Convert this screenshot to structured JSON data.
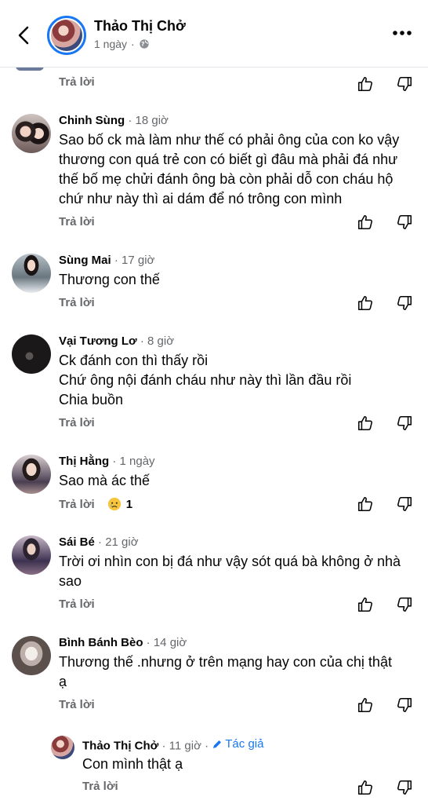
{
  "header": {
    "name": "Thảo Thị Chở",
    "time": "1 ngày",
    "separator": "·"
  },
  "partial_actions": {
    "reply": "Trả lời"
  },
  "comments": [
    {
      "name": "Chinh Sùng",
      "time": "18 giờ",
      "lines": [
        "Sao bố ck mà làm như thế có phải ông của con ko vậy",
        "thương con quá trẻ con có biết gì đâu mà phải đá như",
        "thế bố mẹ chửi đánh ông bà còn phải dỗ con cháu hộ",
        "chứ như này thì ai dám để nó trông con mình"
      ],
      "reply": "Trả lời"
    },
    {
      "name": "Sùng Mai",
      "time": "17 giờ",
      "lines": [
        "Thương con thế"
      ],
      "reply": "Trả lời"
    },
    {
      "name": "Vại Tương Lơ",
      "time": "8 giờ",
      "lines": [
        "Ck đánh con thì thấy rồi",
        "Chứ ông nội đánh cháu như này thì lần đầu rồi",
        "Chia buồn"
      ],
      "reply": "Trả lời"
    },
    {
      "name": "Thị Hằng",
      "time": "1 ngày",
      "lines": [
        "Sao mà ác thế"
      ],
      "reply": "Trả lời",
      "reaction_count": "1",
      "reaction_icon": "sad-emoji-icon"
    },
    {
      "name": "Sái Bé",
      "time": "21 giờ",
      "lines": [
        "Trời ơi nhìn con bị đá như vậy sót quá bà không ở nhà",
        "sao"
      ],
      "reply": "Trả lời"
    },
    {
      "name": "Bình Bánh Bèo",
      "time": "14 giờ",
      "lines": [
        "Thương thế .nhưng ở trên mạng hay con của chị thật",
        "ạ"
      ],
      "reply": "Trả lời"
    }
  ],
  "author_reply": {
    "name": "Thảo Thị Chở",
    "time": "11 giờ",
    "badge": "Tác giả",
    "lines": [
      "Con mình thật ạ"
    ],
    "reply": "Trả lời"
  },
  "colors": {
    "accent": "#1877f2",
    "secondary_text": "#65676b",
    "primary_text": "#050505"
  }
}
